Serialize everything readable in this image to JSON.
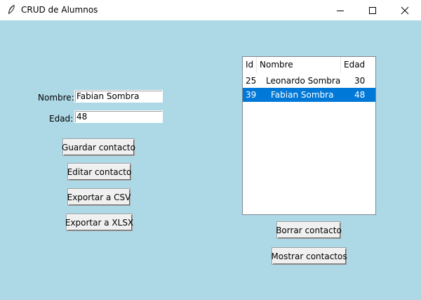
{
  "window": {
    "title": "CRUD de Alumnos",
    "icon": "feather-icon",
    "controls": [
      "minimize-icon",
      "maximize-icon",
      "close-icon"
    ]
  },
  "form": {
    "nombre_label": "Nombre:",
    "nombre_value": "Fabian Sombra",
    "edad_label": "Edad:",
    "edad_value": "48"
  },
  "buttons": {
    "guardar": "Guardar contacto",
    "editar": "Editar contacto",
    "exportar_csv": "Exportar a CSV",
    "exportar_xlsx": "Exportar a XLSX",
    "borrar": "Borrar contacto",
    "mostrar": "Mostrar contactos"
  },
  "table": {
    "columns": [
      "Id",
      "Nombre",
      "Edad"
    ],
    "rows": [
      {
        "id": "25",
        "nombre": "Leonardo Sombra",
        "edad": "30",
        "selected": false
      },
      {
        "id": "39",
        "nombre": "Fabian Sombra",
        "edad": "48",
        "selected": true
      }
    ]
  },
  "colors": {
    "background": "#add8e6",
    "selection": "#0078d7"
  }
}
